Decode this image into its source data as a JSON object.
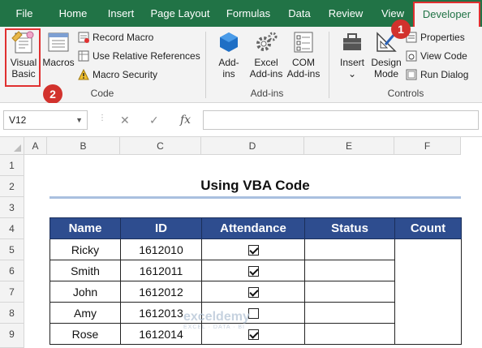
{
  "ribbon_tabs": [
    "File",
    "Home",
    "Insert",
    "Page Layout",
    "Formulas",
    "Data",
    "Review",
    "View",
    "Developer"
  ],
  "code_group": {
    "label": "Code",
    "visual_basic": "Visual Basic",
    "visual_basic_line1": "Visual",
    "visual_basic_line2": "Basic",
    "macros": "Macros",
    "record_macro": "Record Macro",
    "use_relative": "Use Relative References",
    "macro_security": "Macro Security"
  },
  "addins_group": {
    "label": "Add-ins",
    "addins_line1": "Add-",
    "addins_line2": "ins",
    "excel_addins_line1": "Excel",
    "excel_addins_line2": "Add-ins",
    "com_addins_line1": "COM",
    "com_addins_line2": "Add-ins"
  },
  "controls_group": {
    "label": "Controls",
    "insert": "Insert",
    "insert_caret": "⌄",
    "design_mode_line1": "Design",
    "design_mode_line2": "Mode",
    "properties": "Properties",
    "view_code": "View Code",
    "run_dialog": "Run Dialog"
  },
  "badges": {
    "one": "1",
    "two": "2"
  },
  "formula_bar": {
    "name_box": "V12",
    "cancel": "✕",
    "enter": "✓",
    "fx": "fx",
    "formula": ""
  },
  "columns": [
    "A",
    "B",
    "C",
    "D",
    "E",
    "F"
  ],
  "rows": [
    "1",
    "2",
    "3",
    "4",
    "5",
    "6",
    "7",
    "8",
    "9"
  ],
  "sheet": {
    "title": "Using VBA Code",
    "headers": [
      "Name",
      "ID",
      "Attendance",
      "Status",
      "Count"
    ],
    "records": [
      {
        "name": "Ricky",
        "id": "1612010",
        "attendance": true
      },
      {
        "name": "Smith",
        "id": "1612011",
        "attendance": true
      },
      {
        "name": "John",
        "id": "1612012",
        "attendance": true
      },
      {
        "name": "Amy",
        "id": "1612013",
        "attendance": false
      },
      {
        "name": "Rose",
        "id": "1612014",
        "attendance": true
      }
    ]
  },
  "watermark": {
    "brand": "exceldemy",
    "tagline": "EXCEL · DATA · BI"
  },
  "colors": {
    "excel_green": "#217346",
    "table_header": "#2e4d8f",
    "badge_red": "#d2322d"
  }
}
